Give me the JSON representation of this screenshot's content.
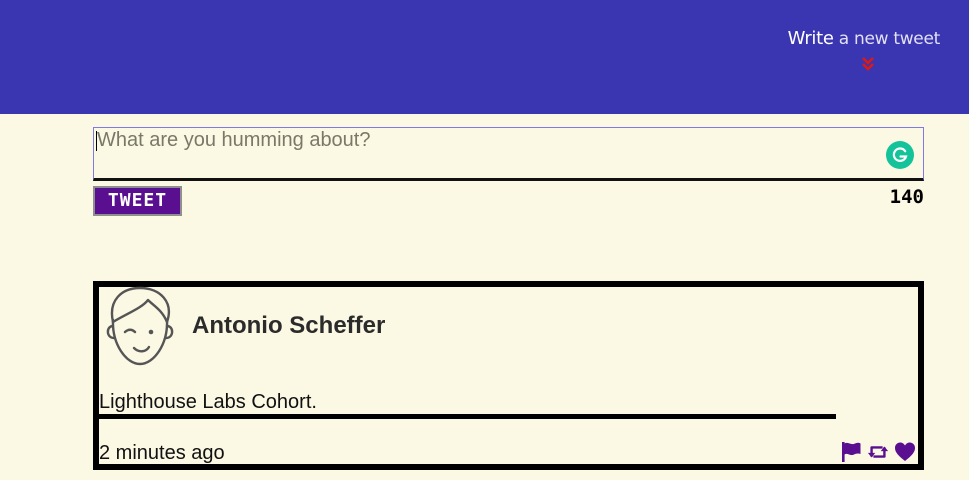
{
  "header": {
    "compose_toggle_strong": "Write",
    "compose_toggle_rest": " a new tweet",
    "chevron_icon": "double-chevron-down-icon",
    "background_color": "#3a35b1",
    "chevron_color": "#d91a1a"
  },
  "compose": {
    "placeholder": "What are you humming about?",
    "value": "",
    "submit_label": "TWEET",
    "counter": "140",
    "grammar_icon": "grammarly-icon"
  },
  "tweets": [
    {
      "author": "Antonio Scheffer",
      "avatar_icon": "cartoon-face-avatar",
      "text": "Lighthouse Labs Cohort.",
      "timestamp": "2 minutes ago",
      "actions": [
        "flag-icon",
        "retweet-icon",
        "heart-icon"
      ],
      "action_color": "#5a0f90"
    }
  ]
}
